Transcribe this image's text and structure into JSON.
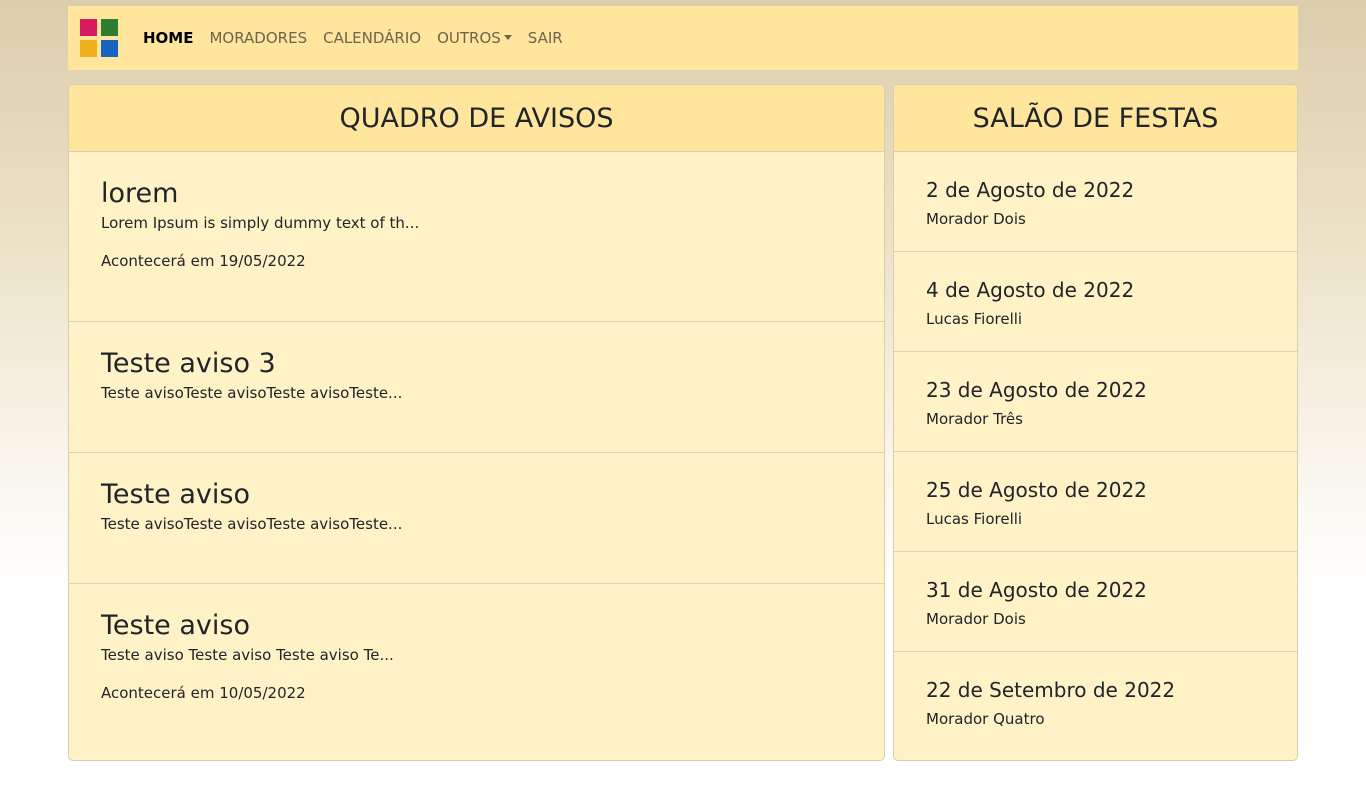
{
  "logo_colors": [
    "#d81b60",
    "#2e7d32",
    "#f2b01e",
    "#1565c0"
  ],
  "nav": {
    "items": [
      {
        "label": "HOME",
        "active": true
      },
      {
        "label": "MORADORES"
      },
      {
        "label": "CALENDÁRIO"
      },
      {
        "label": "OUTROS",
        "dropdown": true
      },
      {
        "label": "SAIR"
      }
    ]
  },
  "avisos": {
    "title": "QUADRO DE AVISOS",
    "items": [
      {
        "title": "lorem",
        "text": "Lorem Ipsum is simply dummy text of th...",
        "date": "Acontecerá em 19/05/2022"
      },
      {
        "title": "Teste aviso 3",
        "text": "Teste avisoTeste avisoTeste avisoTeste...",
        "date": ""
      },
      {
        "title": "Teste aviso",
        "text": "Teste avisoTeste avisoTeste avisoTeste...",
        "date": ""
      },
      {
        "title": "Teste aviso",
        "text": "Teste aviso Teste aviso Teste aviso Te...",
        "date": "Acontecerá em 10/05/2022"
      }
    ]
  },
  "salao": {
    "title": "SALÃO DE FESTAS",
    "items": [
      {
        "date": "2 de Agosto de 2022",
        "name": "Morador Dois"
      },
      {
        "date": "4 de Agosto de 2022",
        "name": "Lucas Fiorelli"
      },
      {
        "date": "23 de Agosto de 2022",
        "name": "Morador Três"
      },
      {
        "date": "25 de Agosto de 2022",
        "name": "Lucas Fiorelli"
      },
      {
        "date": "31 de Agosto de 2022",
        "name": "Morador Dois"
      },
      {
        "date": "22 de Setembro de 2022",
        "name": "Morador Quatro"
      }
    ]
  }
}
